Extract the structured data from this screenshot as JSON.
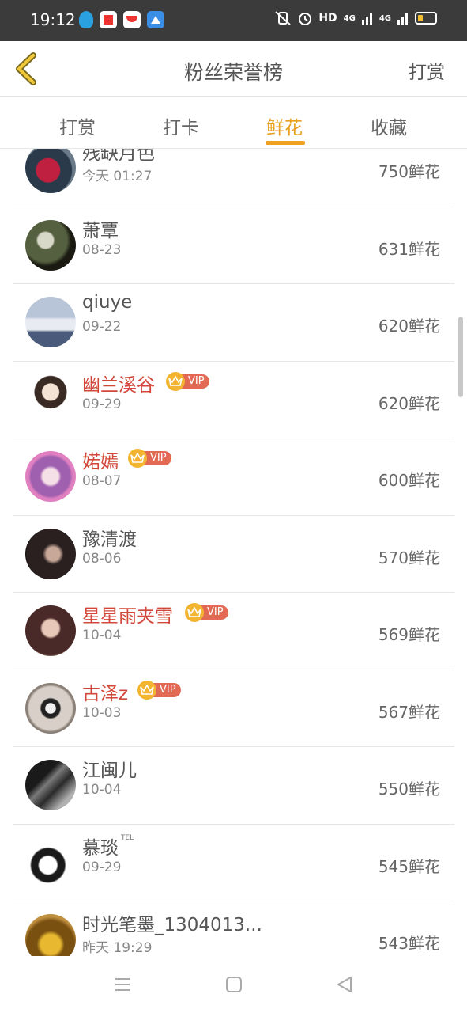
{
  "status_bar": {
    "time": "19:12",
    "network": "HD",
    "signal_1": "4G",
    "signal_2": "4G"
  },
  "header": {
    "title": "粉丝荣誉榜",
    "right_action": "打赏"
  },
  "tabs": [
    {
      "label": "打赏"
    },
    {
      "label": "打卡"
    },
    {
      "label": "鲜花"
    },
    {
      "label": "收藏"
    }
  ],
  "active_tab": "鲜花",
  "vip_label": "VIP",
  "tel_label": "TEL",
  "rows": [
    {
      "name": "残缺月色",
      "date": "今天 01:27",
      "amount": "750鲜花",
      "vip": false
    },
    {
      "name": "萧覃",
      "date": "08-23",
      "amount": "631鲜花",
      "vip": false
    },
    {
      "name": "qiuye",
      "date": "09-22",
      "amount": "620鲜花",
      "vip": false
    },
    {
      "name": "幽兰溪谷",
      "date": "09-29",
      "amount": "620鲜花",
      "vip": true
    },
    {
      "name": "婼嫣",
      "date": "08-07",
      "amount": "600鲜花",
      "vip": true
    },
    {
      "name": "豫清渡",
      "date": "08-06",
      "amount": "570鲜花",
      "vip": false
    },
    {
      "name": "星星雨夹雪",
      "date": "10-04",
      "amount": "569鲜花",
      "vip": true
    },
    {
      "name": "古泽z",
      "date": "10-03",
      "amount": "567鲜花",
      "vip": true
    },
    {
      "name": "江闽儿",
      "date": "10-04",
      "amount": "550鲜花",
      "vip": false
    },
    {
      "name": "慕琰",
      "date": "09-29",
      "amount": "545鲜花",
      "vip": false
    },
    {
      "name": "时光笔墨_1304013...",
      "date": "昨天 19:29",
      "amount": "543鲜花",
      "vip": false
    }
  ],
  "colors": {
    "accent": "#e8a020",
    "vip_name": "#d2473a",
    "status_bar": "#3b3b3b"
  }
}
